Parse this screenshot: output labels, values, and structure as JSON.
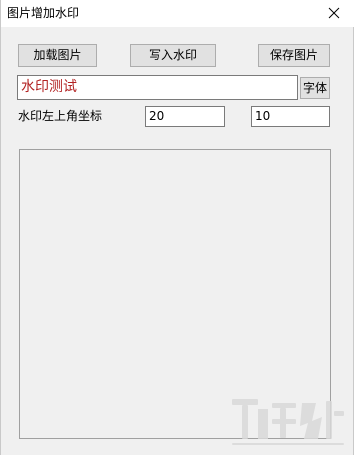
{
  "window": {
    "title": "图片增加水印"
  },
  "toolbar": {
    "load_label": "加载图片",
    "write_label": "写入水印",
    "save_label": "保存图片"
  },
  "watermark": {
    "text_value": "水印测试",
    "font_button_label": "字体",
    "coord_label": "水印左上角坐标",
    "x_value": "20",
    "y_value": "10"
  },
  "icons": {
    "close": "close-icon",
    "watermark_logo": "site-logo-icon"
  },
  "colors": {
    "watermark_text": "#b22222",
    "window_bg": "#f0f0f0"
  }
}
